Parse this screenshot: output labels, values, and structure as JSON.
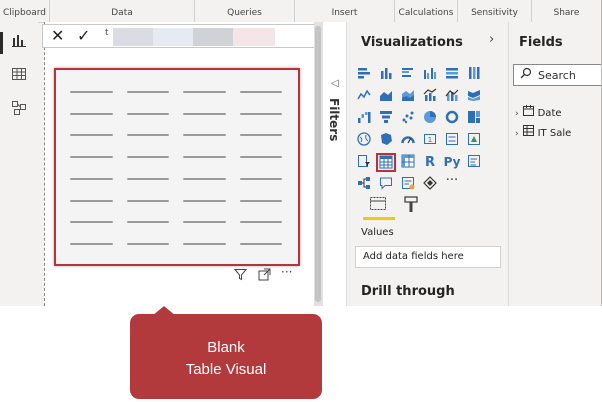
{
  "ribbon": {
    "groups": [
      {
        "label": "Clipboard"
      },
      {
        "label": "Data"
      },
      {
        "label": "Queries"
      },
      {
        "label": "Insert"
      },
      {
        "label": "Calculations"
      },
      {
        "label": "Sensitivity"
      },
      {
        "label": "Share"
      }
    ]
  },
  "formula_bar": {
    "cancel_symbol": "✕",
    "commit_symbol": "✓",
    "text": "t"
  },
  "visual_toolbar": {
    "filter_icon": "filter-icon",
    "focus_icon": "focus-mode-icon",
    "more_icon": "more-options-icon",
    "more_symbol": "···"
  },
  "filters_pane": {
    "label": "Filters"
  },
  "visualizations": {
    "title": "Visualizations",
    "chevron": "›",
    "values_label": "Values",
    "add_fields_placeholder": "Add data fields here",
    "drill_through_label": "Drill through",
    "text_icons": {
      "r_label": "R",
      "py_label": "Py",
      "more_label": "···"
    }
  },
  "fields": {
    "title": "Fields",
    "search_placeholder": "Search",
    "tables": [
      {
        "name": "Date"
      },
      {
        "name": "IT Sale"
      }
    ]
  },
  "callout": {
    "line1": "Blank",
    "line2": "Table Visual"
  },
  "colors": {
    "accent": "#b5343a",
    "callout": "#b23a3c",
    "underline": "#f2c811",
    "icon_blue": "#2f6fb5"
  }
}
